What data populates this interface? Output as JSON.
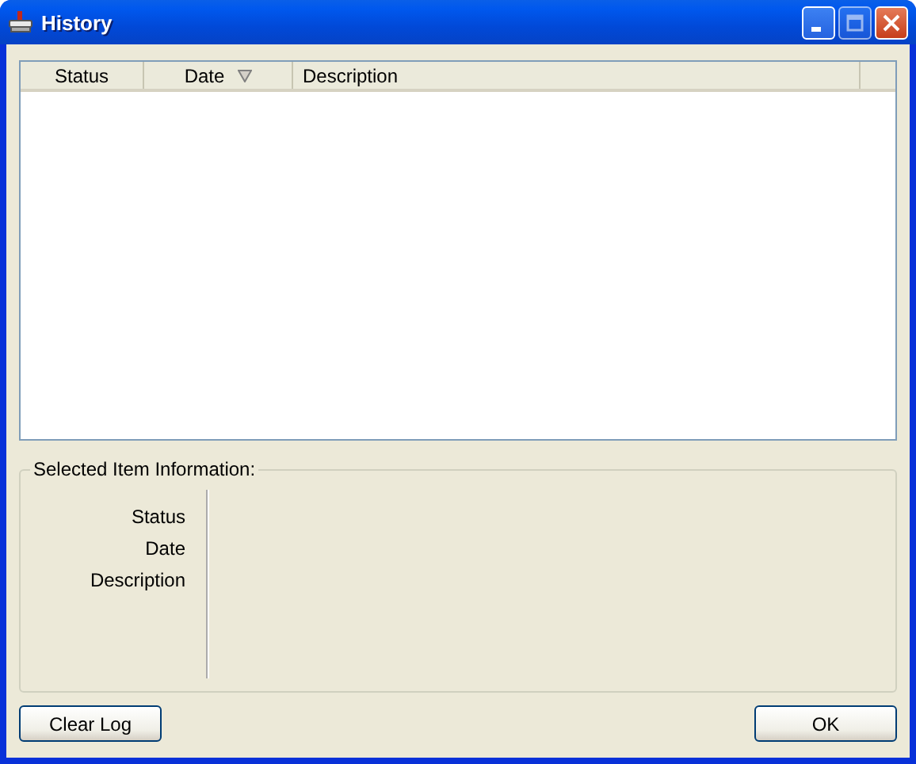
{
  "window": {
    "title": "History"
  },
  "table": {
    "columns": [
      {
        "label": "Status",
        "sorted": false
      },
      {
        "label": "Date",
        "sorted": true
      },
      {
        "label": "Description",
        "sorted": false
      }
    ]
  },
  "details": {
    "title": "Selected Item Information:",
    "fields": [
      "Status",
      "Date",
      "Description"
    ]
  },
  "buttons": [
    "Clear Log",
    "OK"
  ]
}
